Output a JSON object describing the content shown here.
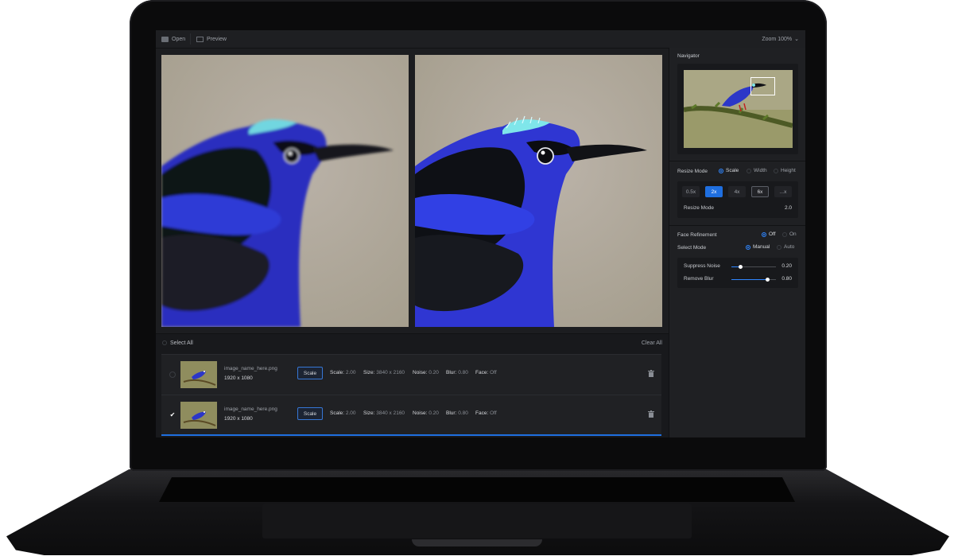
{
  "topbar": {
    "open_label": "Open",
    "preview_label": "Preview",
    "zoom_label": "Zoom 100%"
  },
  "list": {
    "select_all_label": "Select All",
    "clear_all_label": "Clear All",
    "scale_button_label": "Scale",
    "meta_labels": {
      "scale": "Scale:",
      "size": "Size:",
      "noise": "Noise:",
      "blur": "Blur:",
      "face": "Face:"
    },
    "rows": [
      {
        "name": "image_name_here.png",
        "dims": "1920 x 1080",
        "scale": "2.00",
        "size": "3840 x 2160",
        "noise": "0.20",
        "blur": "0.80",
        "face": "Off",
        "selected": false
      },
      {
        "name": "image_name_here.png",
        "dims": "1920 x 1080",
        "scale": "2.00",
        "size": "3840 x 2160",
        "noise": "0.20",
        "blur": "0.80",
        "face": "Off",
        "selected": true
      }
    ]
  },
  "panel": {
    "navigator_label": "Navigator",
    "resize_mode_label": "Resize Mode",
    "resize_options": [
      "Scale",
      "Width",
      "Height"
    ],
    "resize_selected": "Scale",
    "scale_presets": [
      "0.5x",
      "2x",
      "4x",
      "6x",
      "...x"
    ],
    "scale_active": "2x",
    "resize_mode_row_label": "Resize Mode",
    "resize_mode_value": "2.0",
    "face_refinement_label": "Face Refinement",
    "face_options": [
      "Off",
      "On"
    ],
    "face_selected": "Off",
    "select_mode_label": "Select Mode",
    "select_mode_options": [
      "Manual",
      "Auto"
    ],
    "select_mode_selected": "Manual",
    "sliders": [
      {
        "label": "Suppress Noise",
        "value": "0.20",
        "fraction": 0.2
      },
      {
        "label": "Remove Blur",
        "value": "0.80",
        "fraction": 0.8
      }
    ]
  },
  "colors": {
    "accent": "#1f6fe0",
    "screen_bg": "#1c1d20",
    "panel_bg": "#1f2023"
  },
  "icons": {
    "open": "folder-icon",
    "preview": "preview-icon",
    "zoom_menu": "chevron-down-icon",
    "delete": "trash-icon",
    "checked": "checkmark-icon"
  }
}
